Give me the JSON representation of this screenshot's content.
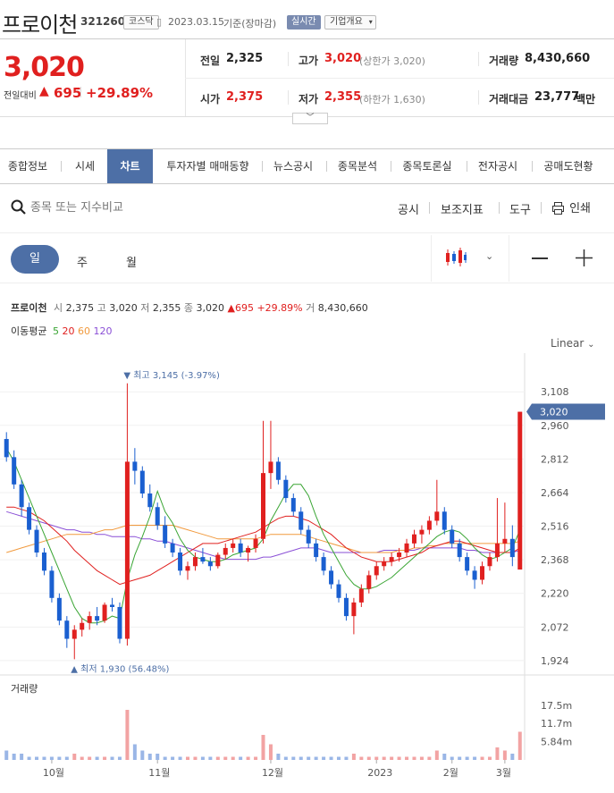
{
  "header": {
    "title": "프로이천",
    "code": "321260",
    "market": "코스닥",
    "date": "2023.03.15",
    "basis": "기준(장마감)",
    "realtime": "실시간",
    "company_overview": "기업개요"
  },
  "price": {
    "current": "3,020",
    "change_label": "전일대비",
    "change": "695",
    "change_pct": "+29.89%"
  },
  "stats": {
    "prev_label": "전일",
    "prev": "2,325",
    "high_label": "고가",
    "high": "3,020",
    "upper_limit": "(상한가 3,020)",
    "volume_label": "거래량",
    "volume": "8,430,660",
    "open_label": "시가",
    "open": "2,375",
    "low_label": "저가",
    "low": "2,355",
    "lower_limit": "(하한가 1,630)",
    "amount_label": "거래대금",
    "amount": "23,777",
    "amount_unit": "백만"
  },
  "tabs": [
    "종합정보",
    "시세",
    "차트",
    "투자자별 매매동향",
    "뉴스공시",
    "종목분석",
    "종목토론실",
    "전자공시",
    "공매도현황"
  ],
  "toolbar": {
    "search_placeholder": "종목 또는 지수비교",
    "disclosure": "공시",
    "indicators": "보조지표",
    "tools": "도구",
    "print": "인쇄"
  },
  "periods": [
    "일",
    "주",
    "월"
  ],
  "info": {
    "name": "프로이천",
    "open_label": "시",
    "open": "2,375",
    "high_label": "고",
    "high": "3,020",
    "low_label": "저",
    "low": "2,355",
    "close_label": "종",
    "close": "3,020",
    "change": "▲695",
    "change_pct": "+29.89%",
    "vol_label": "거",
    "volume": "8,430,660"
  },
  "ma": {
    "label": "이동평균",
    "lines": [
      {
        "period": "5",
        "color": "#3aa534"
      },
      {
        "period": "20",
        "color": "#e0201f"
      },
      {
        "period": "60",
        "color": "#f19a3e"
      },
      {
        "period": "120",
        "color": "#8a4fd6"
      }
    ]
  },
  "scale": "Linear",
  "annotations": {
    "max": "최고 3,145 (-3.97%)",
    "min": "최저 1,930 (56.48%)"
  },
  "volume_title": "거래량",
  "colors": {
    "up": "#e0201f",
    "down": "#1a5fd0",
    "accent": "#4d6fa6"
  },
  "chart_data": {
    "type": "candlestick",
    "y_ticks": [
      "3,108",
      "2,960",
      "2,812",
      "2,664",
      "2,516",
      "2,368",
      "2,220",
      "2,072",
      "1,924"
    ],
    "current_tag": "3,020",
    "x_ticks": [
      "10월",
      "11월",
      "12월",
      "2023",
      "2월",
      "3월"
    ],
    "volume_ticks": [
      "17.5m",
      "11.7m",
      "5.84m"
    ],
    "candles": [
      [
        2900,
        2930,
        2800,
        2820
      ],
      [
        2820,
        2850,
        2680,
        2700
      ],
      [
        2700,
        2720,
        2560,
        2600
      ],
      [
        2600,
        2620,
        2480,
        2500
      ],
      [
        2500,
        2520,
        2380,
        2400
      ],
      [
        2400,
        2420,
        2300,
        2320
      ],
      [
        2320,
        2340,
        2180,
        2200
      ],
      [
        2200,
        2220,
        2080,
        2100
      ],
      [
        2100,
        2120,
        1980,
        2020
      ],
      [
        2020,
        2080,
        1930,
        2060
      ],
      [
        2060,
        2110,
        2030,
        2090
      ],
      [
        2090,
        2140,
        2060,
        2120
      ],
      [
        2120,
        2160,
        2080,
        2100
      ],
      [
        2100,
        2180,
        2090,
        2170
      ],
      [
        2170,
        2200,
        2140,
        2160
      ],
      [
        2160,
        2180,
        2000,
        2020
      ],
      [
        2020,
        3145,
        1990,
        2800
      ],
      [
        2800,
        2860,
        2700,
        2760
      ],
      [
        2760,
        2780,
        2640,
        2660
      ],
      [
        2660,
        2700,
        2580,
        2600
      ],
      [
        2600,
        2620,
        2500,
        2520
      ],
      [
        2520,
        2560,
        2420,
        2440
      ],
      [
        2440,
        2460,
        2380,
        2400
      ],
      [
        2400,
        2420,
        2300,
        2320
      ],
      [
        2320,
        2360,
        2280,
        2340
      ],
      [
        2340,
        2400,
        2320,
        2380
      ],
      [
        2380,
        2420,
        2350,
        2360
      ],
      [
        2360,
        2380,
        2320,
        2340
      ],
      [
        2340,
        2400,
        2330,
        2390
      ],
      [
        2390,
        2440,
        2370,
        2420
      ],
      [
        2420,
        2460,
        2400,
        2440
      ],
      [
        2440,
        2460,
        2380,
        2400
      ],
      [
        2400,
        2430,
        2360,
        2420
      ],
      [
        2420,
        2480,
        2400,
        2460
      ],
      [
        2460,
        2980,
        2440,
        2750
      ],
      [
        2750,
        2980,
        2680,
        2800
      ],
      [
        2800,
        2820,
        2700,
        2720
      ],
      [
        2720,
        2740,
        2620,
        2640
      ],
      [
        2640,
        2660,
        2560,
        2580
      ],
      [
        2580,
        2600,
        2480,
        2500
      ],
      [
        2500,
        2520,
        2420,
        2440
      ],
      [
        2440,
        2460,
        2360,
        2380
      ],
      [
        2380,
        2400,
        2300,
        2320
      ],
      [
        2320,
        2340,
        2240,
        2260
      ],
      [
        2260,
        2280,
        2180,
        2200
      ],
      [
        2200,
        2220,
        2100,
        2120
      ],
      [
        2120,
        2200,
        2040,
        2180
      ],
      [
        2180,
        2260,
        2160,
        2240
      ],
      [
        2240,
        2320,
        2220,
        2300
      ],
      [
        2300,
        2360,
        2280,
        2340
      ],
      [
        2340,
        2380,
        2320,
        2360
      ],
      [
        2360,
        2400,
        2340,
        2380
      ],
      [
        2380,
        2420,
        2360,
        2400
      ],
      [
        2400,
        2460,
        2380,
        2440
      ],
      [
        2440,
        2500,
        2420,
        2480
      ],
      [
        2480,
        2520,
        2440,
        2500
      ],
      [
        2500,
        2560,
        2480,
        2540
      ],
      [
        2540,
        2720,
        2520,
        2580
      ],
      [
        2580,
        2600,
        2480,
        2500
      ],
      [
        2500,
        2520,
        2420,
        2440
      ],
      [
        2440,
        2460,
        2360,
        2380
      ],
      [
        2380,
        2400,
        2300,
        2320
      ],
      [
        2320,
        2340,
        2240,
        2280
      ],
      [
        2280,
        2360,
        2260,
        2340
      ],
      [
        2340,
        2400,
        2320,
        2380
      ],
      [
        2380,
        2640,
        2360,
        2440
      ],
      [
        2440,
        2620,
        2400,
        2460
      ],
      [
        2460,
        2520,
        2340,
        2380
      ],
      [
        2325,
        3020,
        2355,
        3020
      ]
    ],
    "volumes": [
      3,
      2,
      2,
      1,
      1,
      1,
      1,
      1,
      1,
      2,
      1,
      1,
      1,
      1,
      1,
      1,
      16,
      5,
      3,
      2,
      2,
      1,
      1,
      1,
      1,
      1,
      1,
      1,
      1,
      1,
      1,
      1,
      1,
      1,
      8,
      5,
      2,
      1,
      1,
      1,
      1,
      1,
      1,
      1,
      1,
      1,
      2,
      1,
      1,
      1,
      1,
      1,
      1,
      1,
      1,
      1,
      1,
      3,
      2,
      1,
      1,
      1,
      1,
      1,
      1,
      4,
      3,
      2,
      9
    ],
    "ma5": [
      2860,
      2800,
      2720,
      2640,
      2560,
      2480,
      2400,
      2320,
      2240,
      2160,
      2110,
      2090,
      2090,
      2100,
      2120,
      2110,
      2280,
      2390,
      2470,
      2560,
      2670,
      2580,
      2530,
      2460,
      2410,
      2380,
      2370,
      2360,
      2360,
      2370,
      2390,
      2400,
      2410,
      2420,
      2460,
      2540,
      2600,
      2660,
      2700,
      2700,
      2650,
      2560,
      2480,
      2420,
      2360,
      2300,
      2260,
      2240,
      2240,
      2250,
      2270,
      2290,
      2320,
      2350,
      2380,
      2410,
      2440,
      2470,
      2490,
      2500,
      2490,
      2460,
      2420,
      2390,
      2370,
      2380,
      2400,
      2420,
      2500
    ],
    "ma20": [
      2600,
      2600,
      2590,
      2580,
      2560,
      2540,
      2510,
      2480,
      2450,
      2410,
      2380,
      2350,
      2320,
      2300,
      2280,
      2260,
      2270,
      2280,
      2290,
      2300,
      2320,
      2340,
      2360,
      2380,
      2400,
      2420,
      2440,
      2440,
      2440,
      2450,
      2460,
      2470,
      2480,
      2490,
      2510,
      2530,
      2550,
      2560,
      2560,
      2550,
      2540,
      2520,
      2500,
      2480,
      2450,
      2420,
      2400,
      2380,
      2370,
      2360,
      2360,
      2360,
      2370,
      2380,
      2390,
      2400,
      2420,
      2430,
      2440,
      2450,
      2450,
      2440,
      2430,
      2420,
      2410,
      2400,
      2400,
      2400,
      2420
    ],
    "ma60": [
      2400,
      2410,
      2420,
      2430,
      2440,
      2450,
      2460,
      2470,
      2480,
      2480,
      2480,
      2480,
      2490,
      2500,
      2500,
      2510,
      2520,
      2520,
      2520,
      2520,
      2520,
      2520,
      2520,
      2510,
      2500,
      2490,
      2480,
      2470,
      2460,
      2460,
      2460,
      2460,
      2460,
      2460,
      2470,
      2480,
      2480,
      2480,
      2480,
      2480,
      2470,
      2460,
      2450,
      2440,
      2430,
      2420,
      2410,
      2400,
      2400,
      2400,
      2400,
      2400,
      2410,
      2410,
      2420,
      2420,
      2430,
      2430,
      2440,
      2440,
      2440,
      2440,
      2440,
      2440,
      2440,
      2440,
      2440,
      2440,
      2450
    ],
    "ma120": [
      2580,
      2570,
      2560,
      2550,
      2540,
      2530,
      2520,
      2510,
      2500,
      2500,
      2490,
      2490,
      2480,
      2480,
      2470,
      2470,
      2470,
      2470,
      2460,
      2460,
      2450,
      2450,
      2440,
      2430,
      2420,
      2410,
      2400,
      2390,
      2380,
      2370,
      2370,
      2370,
      2370,
      2370,
      2380,
      2380,
      2390,
      2400,
      2410,
      2420,
      2420,
      2420,
      2410,
      2400,
      2400,
      2400,
      2400,
      2400,
      2400,
      2400,
      2410,
      2410,
      2410,
      2410,
      2410,
      2420,
      2420,
      2420,
      2420,
      2420,
      2420,
      2410,
      2410,
      2400,
      2400,
      2400,
      2400,
      2400,
      2410
    ],
    "ylim": [
      1900,
      3160
    ]
  }
}
